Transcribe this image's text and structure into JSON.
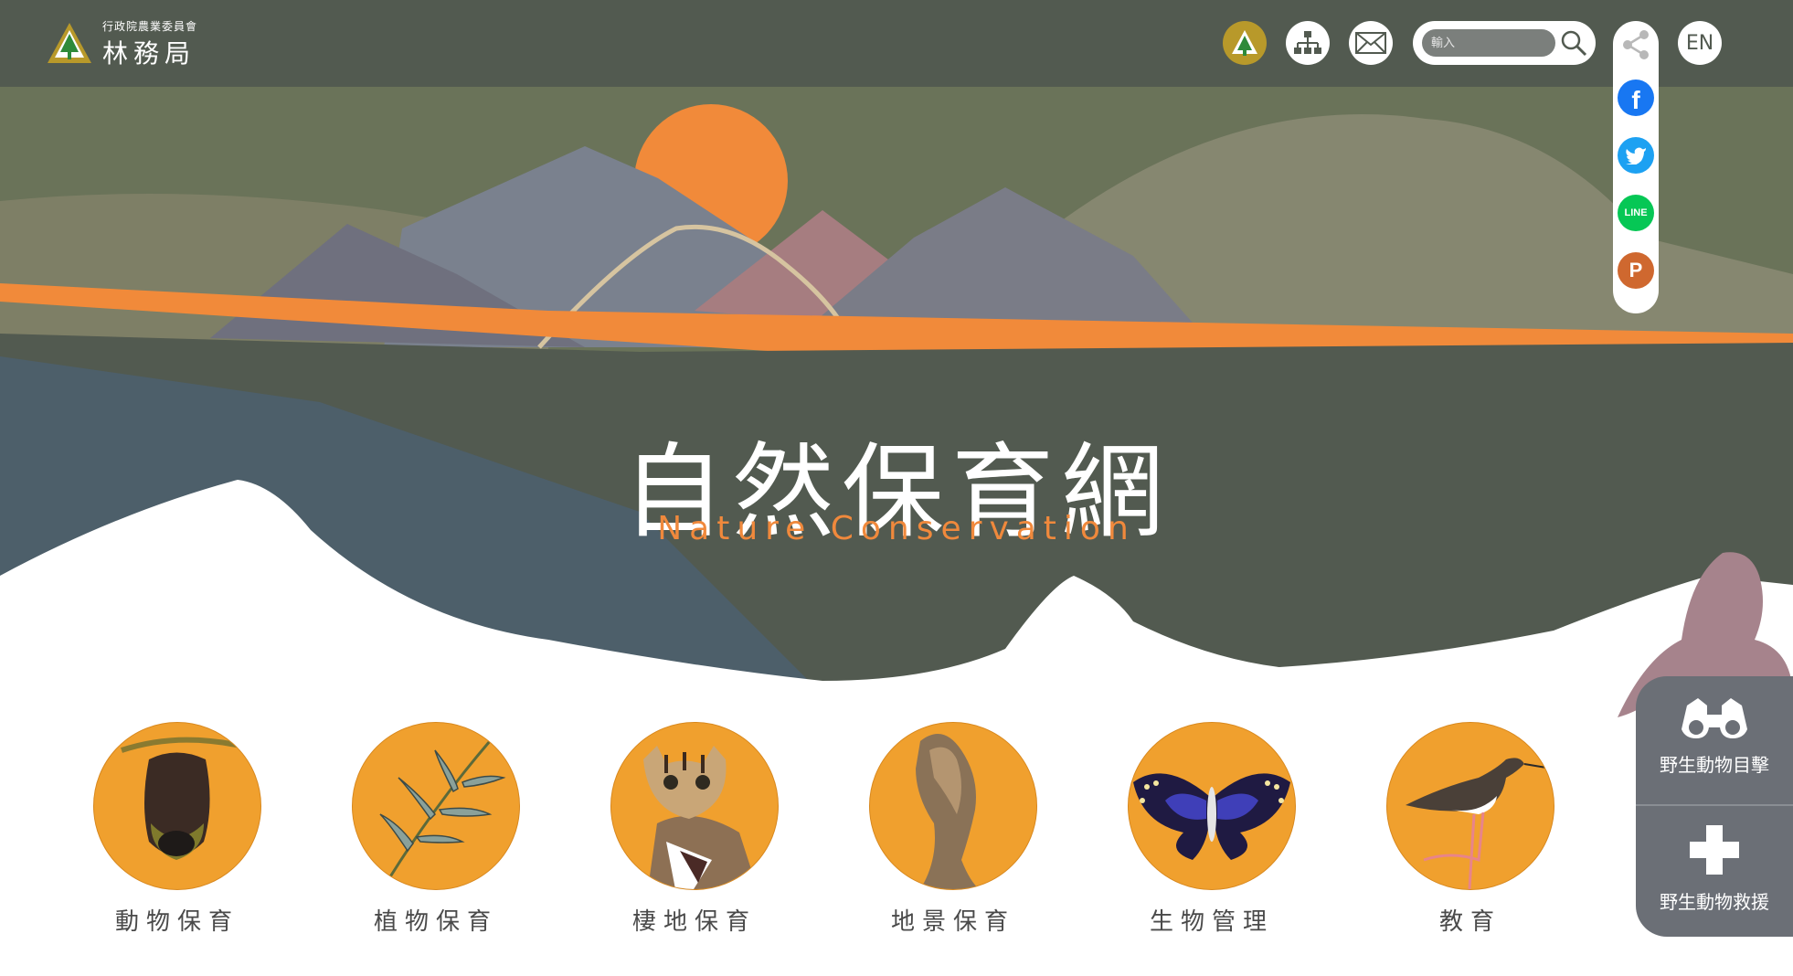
{
  "header": {
    "logo_subtitle": "行政院農業委員會",
    "logo_title": "林務局",
    "search_placeholder": "輸入",
    "lang_label": "EN",
    "icons": [
      "forestry-logo-icon",
      "sitemap-icon",
      "mail-icon",
      "search-icon",
      "share-icon"
    ]
  },
  "share": {
    "items": [
      {
        "name": "facebook",
        "label": "f",
        "color": "#1877f2"
      },
      {
        "name": "twitter",
        "label": "",
        "color": "#1da1f2"
      },
      {
        "name": "line",
        "label": "LINE",
        "color": "#06c755"
      },
      {
        "name": "plurk",
        "label": "P",
        "color": "#cf682f"
      }
    ]
  },
  "hero": {
    "title": "自然保育網",
    "subtitle": "Nature Conservation"
  },
  "categories": [
    {
      "label": "動物保育",
      "icon": "bat-icon"
    },
    {
      "label": "植物保育",
      "icon": "plant-icon"
    },
    {
      "label": "棲地保育",
      "icon": "leopard-cat-icon"
    },
    {
      "label": "地景保育",
      "icon": "rock-formation-icon"
    },
    {
      "label": "生物管理",
      "icon": "butterfly-icon"
    },
    {
      "label": "教育",
      "icon": "stilt-bird-icon"
    }
  ],
  "wildlife": {
    "sighting_label": "野生動物目擊",
    "rescue_label": "野生動物救援"
  },
  "colors": {
    "topbar": "#525a50",
    "accent_orange": "#f0893c",
    "category_circle": "#f0a02e",
    "mountain_green": "#656f57",
    "panel_grey": "#6b6f76"
  }
}
